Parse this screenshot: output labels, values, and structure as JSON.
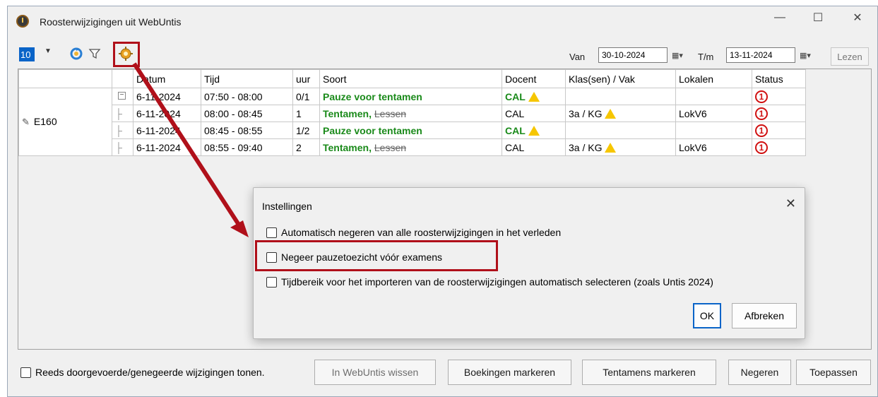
{
  "window": {
    "title": "Roosterwijzigingen uit WebUntis",
    "controls": [
      "minimize",
      "maximize",
      "close"
    ]
  },
  "toolbar": {
    "count_value": "10",
    "icons": [
      "refresh-icon",
      "filter-icon",
      "settings-icon"
    ],
    "van_label": "Van",
    "van_date": "30-10-2024",
    "tm_label": "T/m",
    "tm_date": "13-11-2024",
    "lezen_label": "Lezen"
  },
  "grid": {
    "columns": [
      "Datum",
      "Tijd",
      "uur",
      "Soort",
      "Docent",
      "Klas(sen) / Vak",
      "Lokalen",
      "Status"
    ],
    "group_label": "E160",
    "rows": [
      {
        "datum": "6-11-2024",
        "tijd": "07:50 - 08:00",
        "uur": "0/1",
        "soort": "Pauze voor tentamen",
        "soort_strike": "",
        "docent": "CAL",
        "docent_warn": true,
        "klas": "",
        "klas_warn": false,
        "lokaal": ""
      },
      {
        "datum": "6-11-2024",
        "tijd": "08:00 - 08:45",
        "uur": "1",
        "soort": "Tentamen,",
        "soort_strike": "Lessen",
        "docent": "CAL",
        "docent_warn": false,
        "klas": "3a / KG",
        "klas_warn": true,
        "lokaal": "LokV6"
      },
      {
        "datum": "6-11-2024",
        "tijd": "08:45 - 08:55",
        "uur": "1/2",
        "soort": "Pauze voor tentamen",
        "soort_strike": "",
        "docent": "CAL",
        "docent_warn": true,
        "klas": "",
        "klas_warn": false,
        "lokaal": ""
      },
      {
        "datum": "6-11-2024",
        "tijd": "08:55 - 09:40",
        "uur": "2",
        "soort": "Tentamen,",
        "soort_strike": "Lessen",
        "docent": "CAL",
        "docent_warn": false,
        "klas": "3a / KG",
        "klas_warn": true,
        "lokaal": "LokV6"
      }
    ],
    "status_symbol": "1"
  },
  "bottom": {
    "show_done_label": "Reeds doorgevoerde/genegeerde wijzigingen tonen.",
    "btn_wissen": "In WebUntis wissen",
    "btn_boekingen": "Boekingen markeren",
    "btn_tentamens": "Tentamens markeren",
    "btn_negeren": "Negeren",
    "btn_toepassen": "Toepassen"
  },
  "dialog": {
    "title": "Instellingen",
    "options": [
      "Automatisch negeren van alle roosterwijzigingen in het verleden",
      "Negeer pauzetoezicht vóór examens",
      "Tijdbereik voor het importeren van de roosterwijzigingen automatisch selecteren (zoals Untis 2024)"
    ],
    "ok_label": "OK",
    "cancel_label": "Afbreken"
  },
  "colors": {
    "highlight": "#b0101a",
    "green_text": "#1a8a1a",
    "status_red": "#d01010",
    "selection_blue": "#0a64c8"
  }
}
